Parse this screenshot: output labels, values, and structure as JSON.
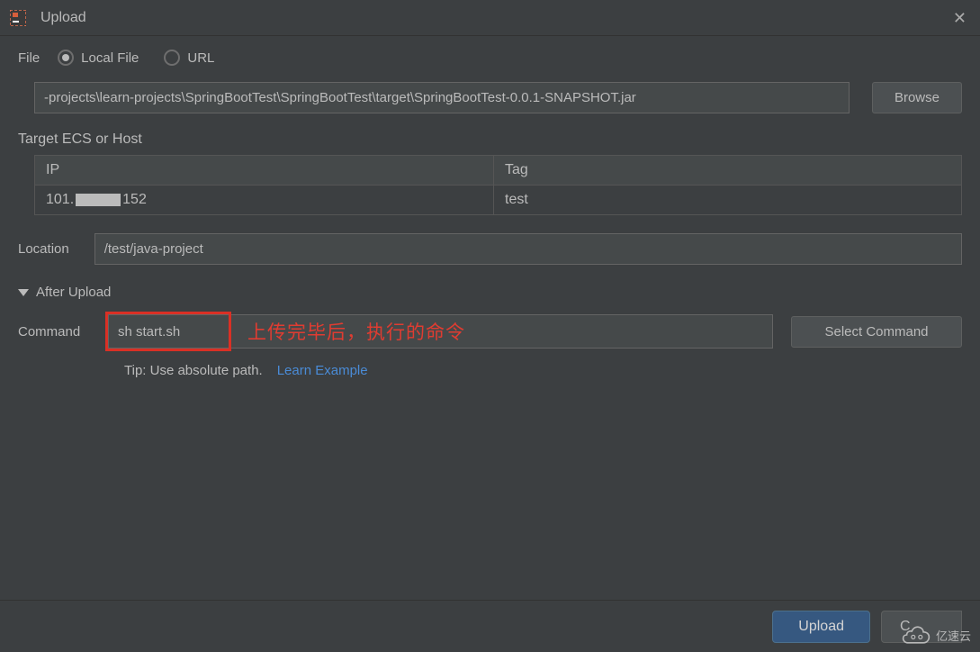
{
  "titleBar": {
    "title": "Upload"
  },
  "file": {
    "label": "File",
    "radioLocal": "Local File",
    "radioUrl": "URL",
    "path": "-projects\\learn-projects\\SpringBootTest\\SpringBootTest\\target\\SpringBootTest-0.0.1-SNAPSHOT.jar",
    "browse": "Browse"
  },
  "target": {
    "label": "Target ECS or Host",
    "colIp": "IP",
    "colTag": "Tag",
    "row": {
      "ipPrefix": "101.",
      "ipSuffix": "152",
      "tag": "test"
    }
  },
  "location": {
    "label": "Location",
    "value": "/test/java-project"
  },
  "afterUpload": {
    "header": "After Upload",
    "commandLabel": "Command",
    "commandValue": "sh start.sh",
    "annotation": "上传完毕后，执行的命令",
    "selectCommand": "Select Command",
    "tip": "Tip: Use absolute path.",
    "learn": "Learn Example"
  },
  "footer": {
    "upload": "Upload",
    "cancel": "C"
  },
  "watermark": {
    "text": "亿速云"
  }
}
